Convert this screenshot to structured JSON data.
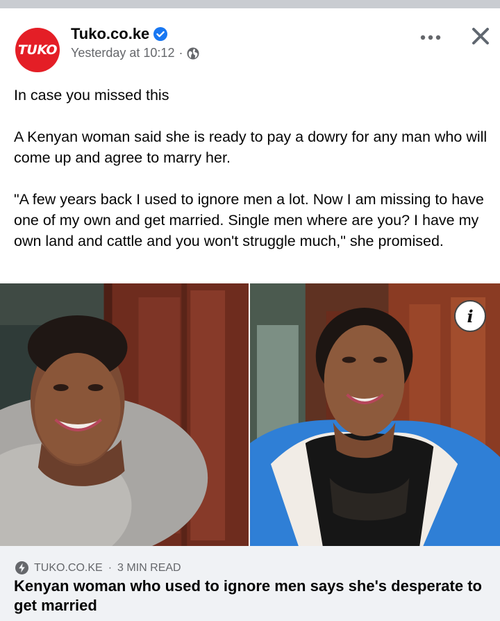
{
  "post": {
    "page_name": "Tuko.co.ke",
    "avatar_text": "TUKO",
    "timestamp": "Yesterday at 10:12",
    "separator": "·",
    "paragraphs": [
      "In case you missed this",
      "A Kenyan woman said she is ready to pay a dowry for any man who will come up and agree to marry her.",
      "\"A few years back I used to ignore men a lot. Now I am missing to have one of my own and get married. Single men where are you? I have my own land and cattle and you won't struggle much,\" she promised."
    ],
    "info_label": "i"
  },
  "link_preview": {
    "source": "TUKO.CO.KE",
    "separator": "·",
    "read_time": "3 MIN READ",
    "title": "Kenyan woman who used to ignore men says she's desperate to get married"
  },
  "icons": {
    "verified": "verified-badge-icon",
    "privacy": "globe-icon",
    "more": "more-options-icon",
    "close": "close-icon",
    "info": "info-icon",
    "instant_article": "lightning-bolt-icon"
  },
  "colors": {
    "brand_red": "#e41e26",
    "verified_blue": "#1877f2",
    "secondary_text": "#65676b",
    "preview_bg": "#f0f2f5"
  }
}
